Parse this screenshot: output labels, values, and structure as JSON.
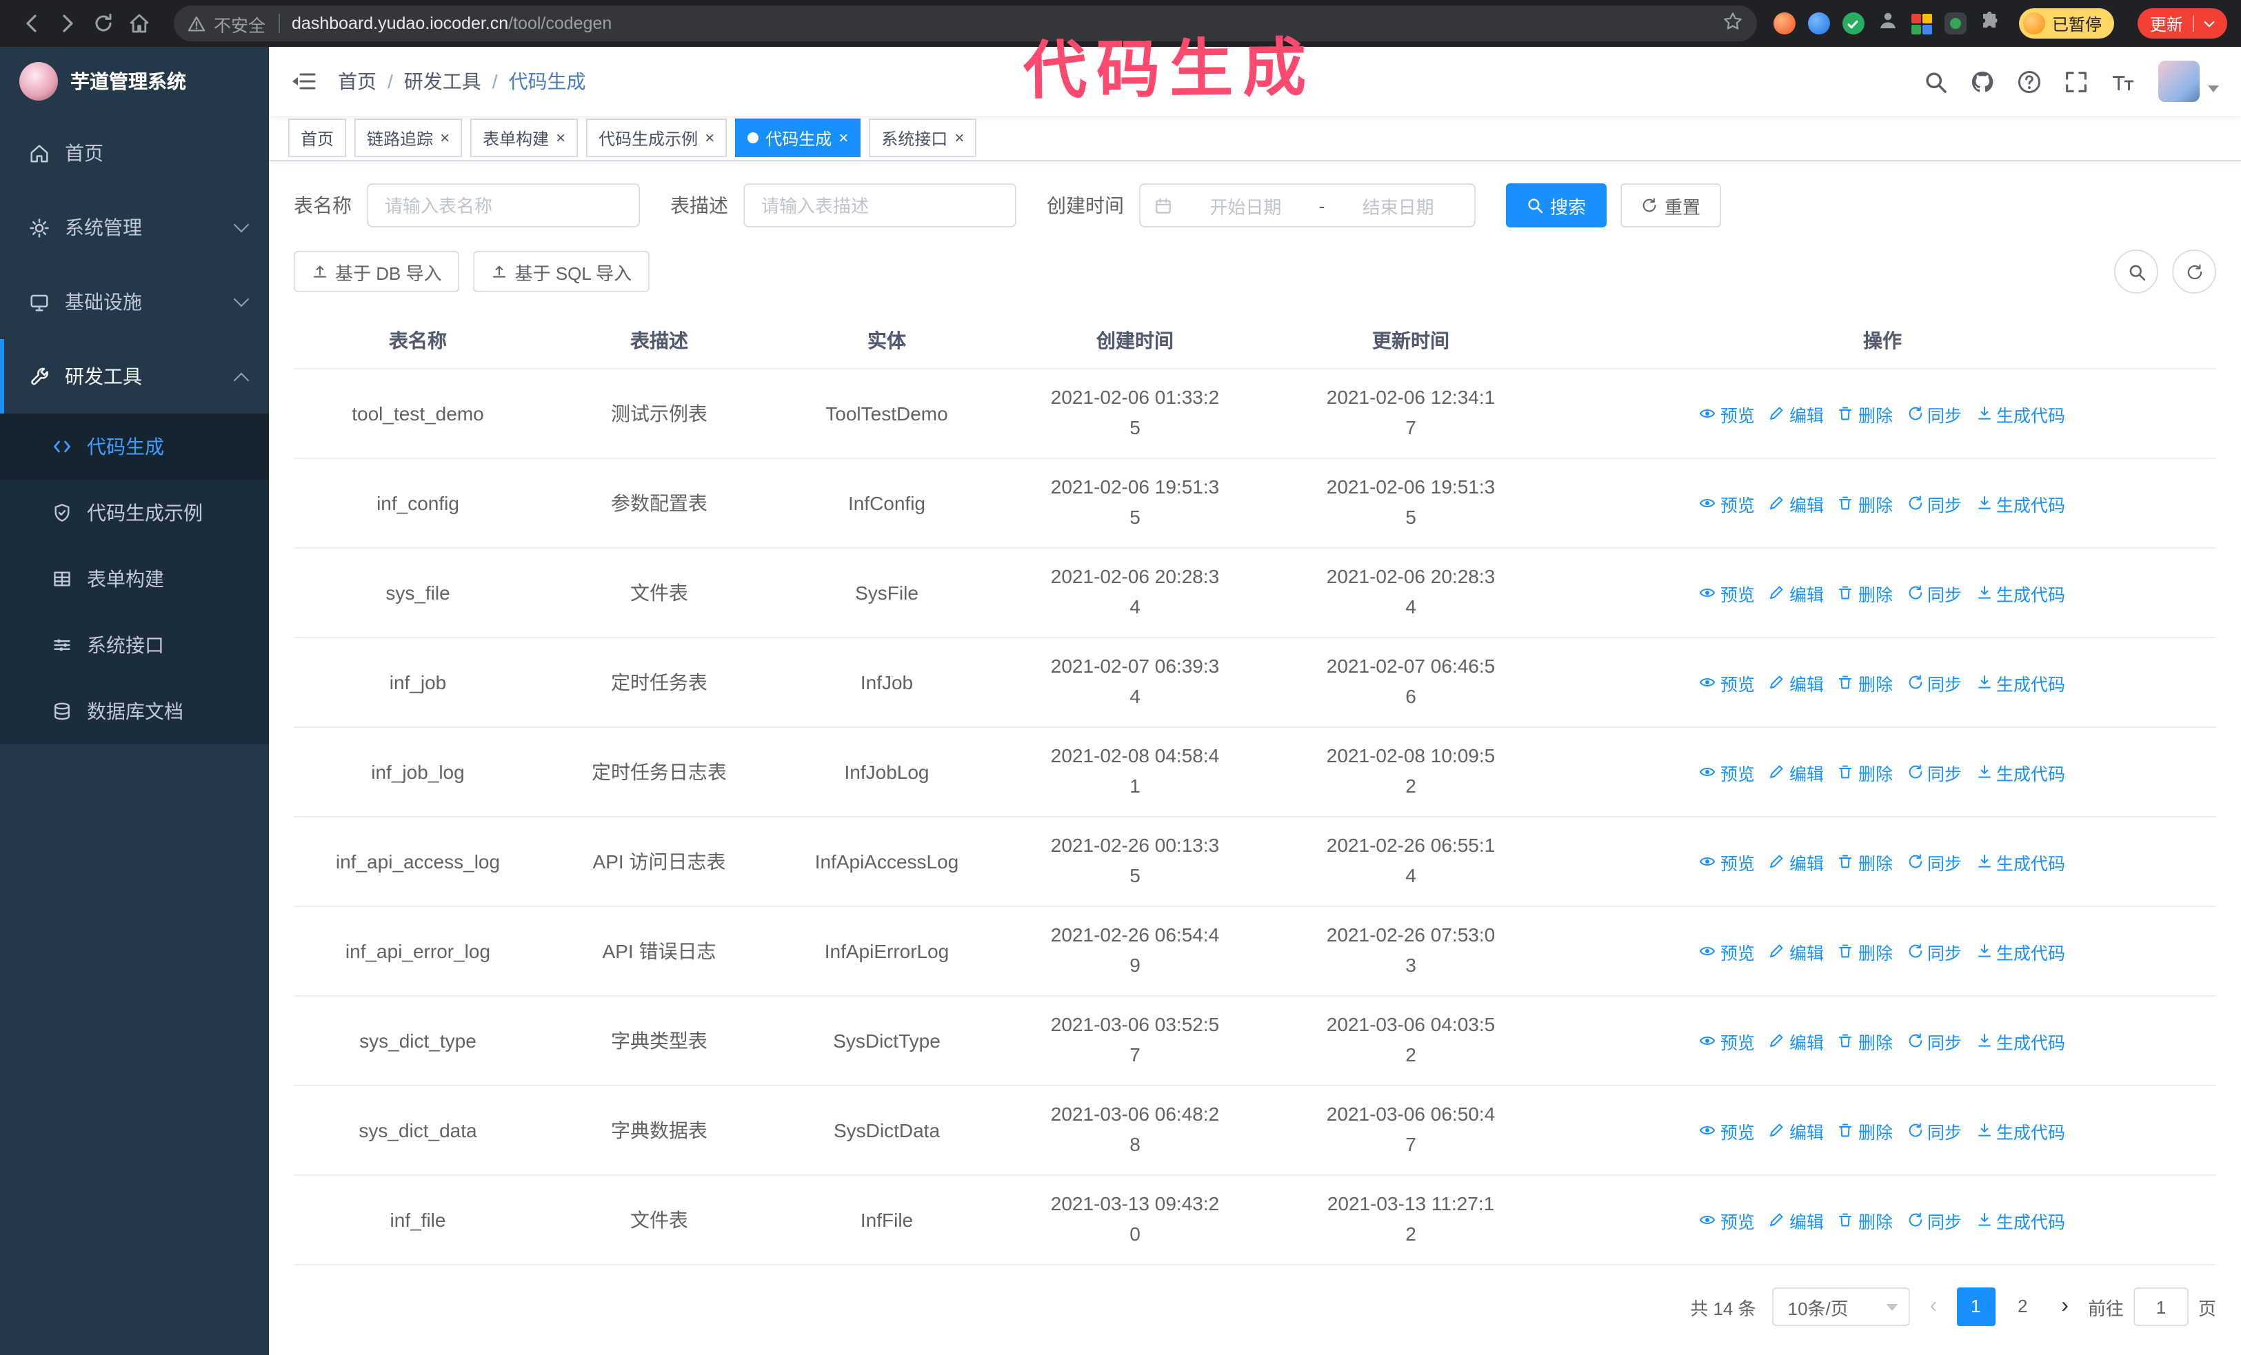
{
  "annotation": "代码生成",
  "browser": {
    "security_label": "不安全",
    "url_domain": "dashboard.yudao.iocoder.cn",
    "url_path": "/tool/codegen",
    "paused_badge": "已暂停",
    "update_button": "更新"
  },
  "sidebar": {
    "logo_title": "芋道管理系统",
    "items": [
      {
        "label": "首页"
      },
      {
        "label": "系统管理"
      },
      {
        "label": "基础设施"
      },
      {
        "label": "研发工具"
      }
    ],
    "subitems": [
      {
        "label": "代码生成",
        "active": true
      },
      {
        "label": "代码生成示例"
      },
      {
        "label": "表单构建"
      },
      {
        "label": "系统接口"
      },
      {
        "label": "数据库文档"
      }
    ]
  },
  "header": {
    "breadcrumb": [
      "首页",
      "研发工具",
      "代码生成"
    ],
    "separator": "/"
  },
  "tabs": [
    {
      "label": "首页",
      "closable": false,
      "active": false
    },
    {
      "label": "链路追踪",
      "closable": true,
      "active": false
    },
    {
      "label": "表单构建",
      "closable": true,
      "active": false
    },
    {
      "label": "代码生成示例",
      "closable": true,
      "active": false
    },
    {
      "label": "代码生成",
      "closable": true,
      "active": true
    },
    {
      "label": "系统接口",
      "closable": true,
      "active": false
    }
  ],
  "filters": {
    "table_name_label": "表名称",
    "table_name_placeholder": "请输入表名称",
    "table_desc_label": "表描述",
    "table_desc_placeholder": "请输入表描述",
    "create_time_label": "创建时间",
    "date_start_placeholder": "开始日期",
    "date_separator": "-",
    "date_end_placeholder": "结束日期",
    "search_button": "搜索",
    "reset_button": "重置"
  },
  "toolbar": {
    "import_db": "基于 DB 导入",
    "import_sql": "基于 SQL 导入"
  },
  "table": {
    "columns": [
      "表名称",
      "表描述",
      "实体",
      "创建时间",
      "更新时间",
      "操作"
    ],
    "actions": [
      {
        "label": "预览",
        "icon": "eye"
      },
      {
        "label": "编辑",
        "icon": "edit"
      },
      {
        "label": "删除",
        "icon": "delete"
      },
      {
        "label": "同步",
        "icon": "sync"
      },
      {
        "label": "生成代码",
        "icon": "download"
      }
    ],
    "rows": [
      {
        "name": "tool_test_demo",
        "desc": "测试示例表",
        "entity": "ToolTestDemo",
        "created": "2021-02-06 01:33:25",
        "updated": "2021-02-06 12:34:17"
      },
      {
        "name": "inf_config",
        "desc": "参数配置表",
        "entity": "InfConfig",
        "created": "2021-02-06 19:51:35",
        "updated": "2021-02-06 19:51:35"
      },
      {
        "name": "sys_file",
        "desc": "文件表",
        "entity": "SysFile",
        "created": "2021-02-06 20:28:34",
        "updated": "2021-02-06 20:28:34"
      },
      {
        "name": "inf_job",
        "desc": "定时任务表",
        "entity": "InfJob",
        "created": "2021-02-07 06:39:34",
        "updated": "2021-02-07 06:46:56"
      },
      {
        "name": "inf_job_log",
        "desc": "定时任务日志表",
        "entity": "InfJobLog",
        "created": "2021-02-08 04:58:41",
        "updated": "2021-02-08 10:09:52"
      },
      {
        "name": "inf_api_access_log",
        "desc": "API 访问日志表",
        "entity": "InfApiAccessLog",
        "created": "2021-02-26 00:13:35",
        "updated": "2021-02-26 06:55:14"
      },
      {
        "name": "inf_api_error_log",
        "desc": "API 错误日志",
        "entity": "InfApiErrorLog",
        "created": "2021-02-26 06:54:49",
        "updated": "2021-02-26 07:53:03"
      },
      {
        "name": "sys_dict_type",
        "desc": "字典类型表",
        "entity": "SysDictType",
        "created": "2021-03-06 03:52:57",
        "updated": "2021-03-06 04:03:52"
      },
      {
        "name": "sys_dict_data",
        "desc": "字典数据表",
        "entity": "SysDictData",
        "created": "2021-03-06 06:48:28",
        "updated": "2021-03-06 06:50:47"
      },
      {
        "name": "inf_file",
        "desc": "文件表",
        "entity": "InfFile",
        "created": "2021-03-13 09:43:20",
        "updated": "2021-03-13 11:27:12"
      }
    ]
  },
  "pagination": {
    "total": "共 14 条",
    "page_size": "10条/页",
    "prev": "‹",
    "next": "›",
    "pages": [
      "1",
      "2"
    ],
    "active_page": "1",
    "goto_label": "前往",
    "goto_value": "1",
    "goto_unit": "页"
  },
  "ui": {
    "close": "×"
  },
  "colors": {
    "primary": "#1890ff",
    "annotation": "#fb4a6e",
    "sidebar_bg": "#24384a"
  }
}
